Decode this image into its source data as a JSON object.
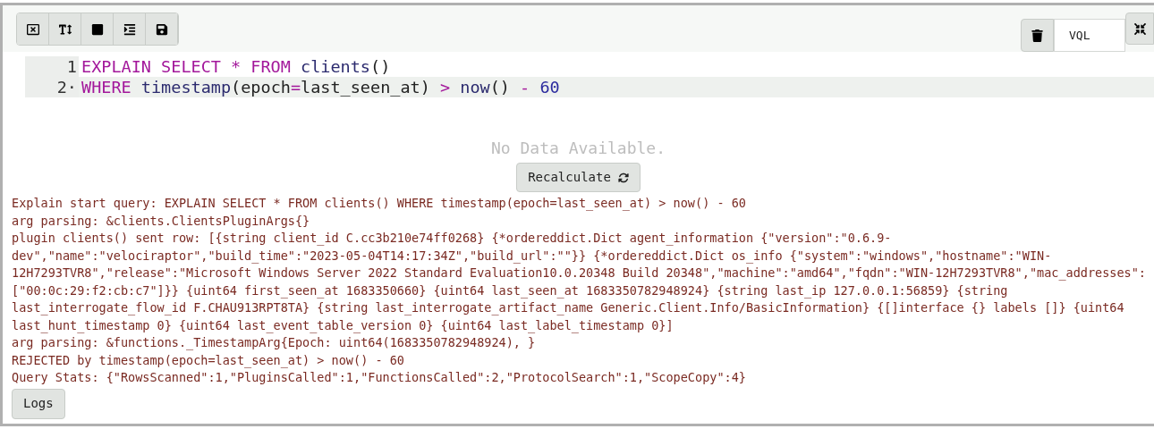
{
  "toolbar": {
    "buttons": [
      {
        "kind": "close"
      },
      {
        "kind": "font-size"
      },
      {
        "kind": "stop"
      },
      {
        "kind": "indent"
      },
      {
        "kind": "save"
      }
    ],
    "language": "VQL"
  },
  "editor": {
    "lines": [
      {
        "number": "1",
        "active": false,
        "tokens": [
          {
            "kind": "keyword",
            "text": "EXPLAIN SELECT * FROM "
          },
          {
            "kind": "func",
            "text": "clients"
          },
          {
            "kind": "plain",
            "text": "()"
          }
        ]
      },
      {
        "number": "2·",
        "active": true,
        "tokens": [
          {
            "kind": "keyword",
            "text": "WHERE "
          },
          {
            "kind": "func",
            "text": "timestamp"
          },
          {
            "kind": "plain",
            "text": "(epoch"
          },
          {
            "kind": "keyword",
            "text": "="
          },
          {
            "kind": "plain",
            "text": "last_seen_at) "
          },
          {
            "kind": "keyword",
            "text": "> "
          },
          {
            "kind": "func",
            "text": "now"
          },
          {
            "kind": "plain",
            "text": "() "
          },
          {
            "kind": "keyword",
            "text": "- "
          },
          {
            "kind": "number",
            "text": "60"
          }
        ]
      }
    ]
  },
  "results": {
    "empty_message": "No Data Available.",
    "recalculate": "Recalculate"
  },
  "logs": [
    "Explain start query: EXPLAIN SELECT * FROM clients() WHERE timestamp(epoch=last_seen_at) > now() - 60",
    "arg parsing: &clients.ClientsPluginArgs{}",
    "plugin clients() sent row: [{string client_id C.cc3b210e74ff0268} {*ordereddict.Dict agent_information {\"version\":\"0.6.9-dev\",\"name\":\"velociraptor\",\"build_time\":\"2023-05-04T14:17:34Z\",\"build_url\":\"\"}} {*ordereddict.Dict os_info {\"system\":\"windows\",\"hostname\":\"WIN-12H7293TVR8\",\"release\":\"Microsoft Windows Server 2022 Standard Evaluation10.0.20348 Build 20348\",\"machine\":\"amd64\",\"fqdn\":\"WIN-12H7293TVR8\",\"mac_addresses\":[\"00:0c:29:f2:cb:c7\"]}} {uint64 first_seen_at 1683350660} {uint64 last_seen_at 1683350782948924} {string last_ip 127.0.0.1:56859} {string last_interrogate_flow_id F.CHAU913RPT8TA} {string last_interrogate_artifact_name Generic.Client.Info/BasicInformation} {[]interface {} labels []} {uint64 last_hunt_timestamp 0} {uint64 last_event_table_version 0} {uint64 last_label_timestamp 0}]",
    "arg parsing: &functions._TimestampArg{Epoch: uint64(1683350782948924), }",
    "REJECTED by timestamp(epoch=last_seen_at) > now() - 60",
    "Query Stats: {\"RowsScanned\":1,\"PluginsCalled\":1,\"FunctionsCalled\":2,\"ProtocolSearch\":1,\"ScopeCopy\":4}"
  ],
  "logs_button": "Logs"
}
